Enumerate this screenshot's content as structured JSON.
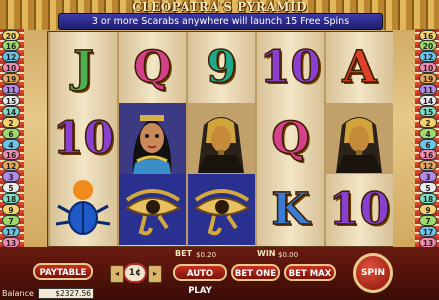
{
  "game": {
    "title": "CLEOPATRA'S PYRAMID",
    "banner": "3 or more Scarabs anywhere will launch 15 Free Spins"
  },
  "paylines": {
    "left": [
      "20",
      "16",
      "12",
      "10",
      "19",
      "11",
      "15",
      "14",
      "2",
      "6",
      "4",
      "16",
      "12",
      "3",
      "5",
      "18",
      "9",
      "7",
      "17",
      "13"
    ],
    "right": [
      "16",
      "20",
      "12",
      "10",
      "19",
      "11",
      "14",
      "15",
      "2",
      "4",
      "6",
      "16",
      "12",
      "3",
      "5",
      "18",
      "9",
      "7",
      "17",
      "13"
    ]
  },
  "reels": [
    [
      "J",
      "10",
      "scarab"
    ],
    [
      "Q",
      "cleopatra",
      "eye-of-horus"
    ],
    [
      "9",
      "sphinx",
      "eye-of-horus"
    ],
    [
      "10",
      "Q",
      "K"
    ],
    [
      "A",
      "sphinx",
      "10"
    ]
  ],
  "controls": {
    "bet_label": "BET",
    "bet_value": "$0.20",
    "win_label": "WIN",
    "win_value": "$0.00",
    "paytable": "PAYTABLE",
    "coin": "1¢",
    "auto_play": "AUTO PLAY",
    "bet_one": "BET ONE",
    "bet_max": "BET MAX",
    "spin": "SPIN",
    "balance_label": "Balance",
    "balance_value": "$2327.56"
  },
  "colors": {
    "J": "#4caf50",
    "Q": "#d4408a",
    "9": "#1fa88a",
    "10": "#8a3fd0",
    "A": "#e0402a",
    "K": "#3a7ad0"
  }
}
